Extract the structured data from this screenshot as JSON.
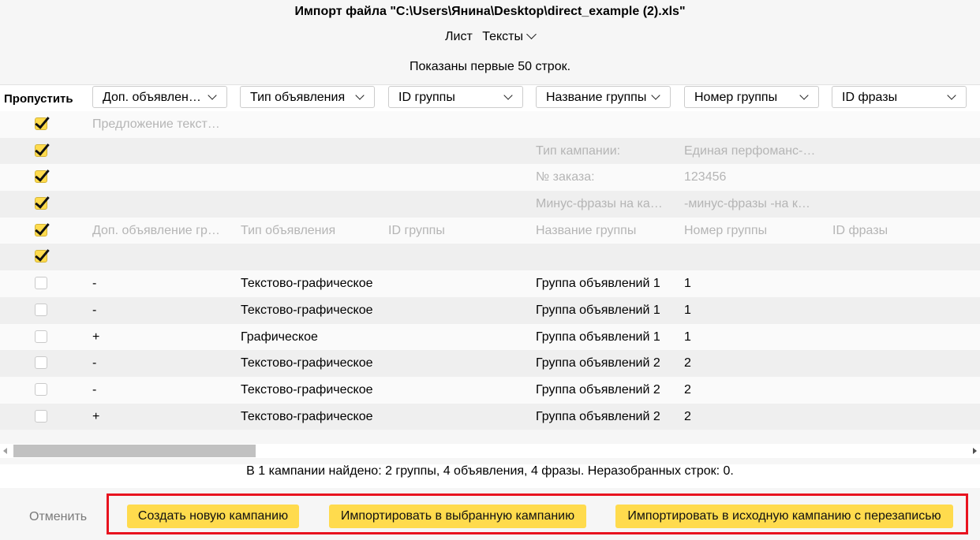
{
  "title": "Импорт файла \"C:\\Users\\Янина\\Desktop\\direct_example (2).xls\"",
  "sheet": {
    "label": "Лист",
    "value": "Тексты"
  },
  "shown_text": "Показаны первые 50 строк.",
  "skip_label": "Пропустить",
  "columns": [
    "Доп. объявлен…",
    "Тип объявления",
    "ID группы",
    "Название группы",
    "Номер группы",
    "ID фразы"
  ],
  "rows": [
    {
      "checked": true,
      "dim": true,
      "cells": [
        "Предложение текст…",
        "",
        "",
        "",
        "",
        ""
      ]
    },
    {
      "checked": true,
      "dim": true,
      "cells": [
        "",
        "",
        "",
        "Тип кампании:",
        "Единая перфоманс-…",
        ""
      ]
    },
    {
      "checked": true,
      "dim": true,
      "cells": [
        "",
        "",
        "",
        "№ заказа:",
        "123456",
        ""
      ]
    },
    {
      "checked": true,
      "dim": true,
      "cells": [
        "",
        "",
        "",
        "Минус-фразы на ка…",
        "-минус-фразы -на к…",
        ""
      ]
    },
    {
      "checked": true,
      "dim": true,
      "cells": [
        "Доп. объявление гр…",
        "Тип объявления",
        "ID группы",
        "Название группы",
        "Номер группы",
        "ID фразы"
      ]
    },
    {
      "checked": true,
      "dim": true,
      "cells": [
        "",
        "",
        "",
        "",
        "",
        ""
      ]
    },
    {
      "checked": false,
      "dim": false,
      "cells": [
        "-",
        "Текстово-графическое",
        "",
        "Группа объявлений 1",
        "1",
        ""
      ]
    },
    {
      "checked": false,
      "dim": false,
      "cells": [
        "-",
        "Текстово-графическое",
        "",
        "Группа объявлений 1",
        "1",
        ""
      ]
    },
    {
      "checked": false,
      "dim": false,
      "cells": [
        "+",
        "Графическое",
        "",
        "Группа объявлений 1",
        "1",
        ""
      ]
    },
    {
      "checked": false,
      "dim": false,
      "cells": [
        "-",
        "Текстово-графическое",
        "",
        "Группа объявлений 2",
        "2",
        ""
      ]
    },
    {
      "checked": false,
      "dim": false,
      "cells": [
        "-",
        "Текстово-графическое",
        "",
        "Группа объявлений 2",
        "2",
        ""
      ]
    },
    {
      "checked": false,
      "dim": false,
      "cells": [
        "+",
        "Текстово-графическое",
        "",
        "Группа объявлений 2",
        "2",
        ""
      ]
    }
  ],
  "summary": "В 1 кампании найдено: 2 группы, 4 объявления, 4 фразы. Неразобранных строк: 0.",
  "buttons": {
    "cancel": "Отменить",
    "create_new": "Создать новую кампанию",
    "import_selected": "Импортировать в выбранную кампанию",
    "import_source": "Импортировать в исходную кампанию с перезаписью"
  },
  "colors": {
    "accent": "#ffdb4d",
    "highlight_border": "#e8131f"
  }
}
